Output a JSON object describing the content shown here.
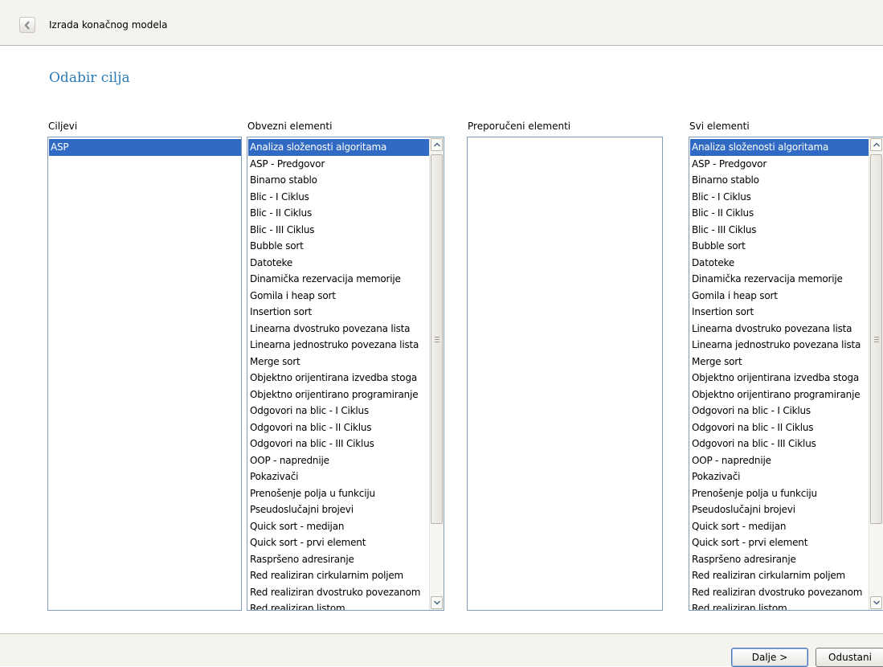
{
  "header": {
    "title": "Izrada konačnog modela",
    "back_icon": "chevron-left-icon"
  },
  "page": {
    "title": "Odabir cilja"
  },
  "colors": {
    "accent": "#2b7ab6",
    "selection": "#316ac5"
  },
  "columns": {
    "ciljevi": {
      "label": "Ciljevi",
      "items": [
        "ASP"
      ],
      "selected_index": 0
    },
    "obvezni": {
      "label": "Obvezni elementi",
      "selected_index": 0,
      "items": [
        "Analiza složenosti algoritama",
        "ASP - Predgovor",
        "Binarno stablo",
        "Blic - I Ciklus",
        "Blic - II Ciklus",
        "Blic - III Ciklus",
        "Bubble sort",
        "Datoteke",
        "Dinamička rezervacija memorije",
        "Gomila i heap sort",
        "Insertion sort",
        "Linearna dvostruko povezana lista",
        "Linearna jednostruko povezana lista",
        "Merge sort",
        "Objektno orijentirana izvedba stoga",
        "Objektno orijentirano programiranje",
        "Odgovori na blic - I Ciklus",
        "Odgovori na blic - II Ciklus",
        "Odgovori na blic - III Ciklus",
        "OOP - naprednije",
        "Pokazivači",
        "Prenošenje polja u funkciju",
        "Pseudoslučajni brojevi",
        "Quick sort - medijan",
        "Quick sort - prvi element",
        "Raspršeno adresiranje",
        "Red realiziran cirkularnim poljem",
        "Red realiziran dvostruko povezanom",
        "Red realiziran listom"
      ]
    },
    "preporuceni": {
      "label": "Preporučeni elementi",
      "items": []
    },
    "svi": {
      "label": "Svi elementi",
      "selected_index": 0,
      "items": [
        "Analiza složenosti algoritama",
        "ASP - Predgovor",
        "Binarno stablo",
        "Blic - I Ciklus",
        "Blic - II Ciklus",
        "Blic - III Ciklus",
        "Bubble sort",
        "Datoteke",
        "Dinamička rezervacija memorije",
        "Gomila i heap sort",
        "Insertion sort",
        "Linearna dvostruko povezana lista",
        "Linearna jednostruko povezana lista",
        "Merge sort",
        "Objektno orijentirana izvedba stoga",
        "Objektno orijentirano programiranje",
        "Odgovori na blic - I Ciklus",
        "Odgovori na blic - II Ciklus",
        "Odgovori na blic - III Ciklus",
        "OOP - naprednije",
        "Pokazivači",
        "Prenošenje polja u funkciju",
        "Pseudoslučajni brojevi",
        "Quick sort - medijan",
        "Quick sort - prvi element",
        "Raspršeno adresiranje",
        "Red realiziran cirkularnim poljem",
        "Red realiziran dvostruko povezanom",
        "Red realiziran listom"
      ]
    }
  },
  "footer": {
    "next_label": "Dalje >",
    "cancel_label": "Odustani"
  }
}
